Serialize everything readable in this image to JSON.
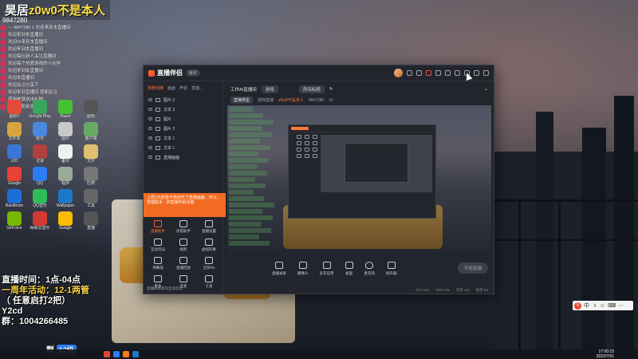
{
  "overlay": {
    "title_prefix": "昊居",
    "title_name": "z0w0不是本人",
    "count": "9847280",
    "chat": [
      "--- 9847280 1 欢迎来到本直播间",
      "欢迎来到本直播间",
      "欢迎ID来到本直播间",
      "欢迎来到本直播间",
      "欢迎每位新人关注直播间",
      "欢迎每个热爱游戏的小伙伴",
      "欢迎来到本直播间",
      "欢迎本直播间",
      "欢迎关注分享下",
      "欢迎来到直播间 感谢关注",
      "感谢老铁送出礼物",
      "欢迎新朋友加入"
    ],
    "schedule_line1": "直播时间：1点-04点",
    "schedule_line2": "一周年活动：12-1两管",
    "schedule_line3": "（ 任意启打2把）",
    "schedule_user": "Y2cd",
    "qq_group": "群：1004266485",
    "fan_group": "群",
    "fan_level": "12级"
  },
  "desktop_icons": [
    {
      "label": "图标1",
      "color": "#e34b3a"
    },
    {
      "label": "Google Play",
      "color": "#3aa55c"
    },
    {
      "label": "Razer",
      "color": "#44c033"
    },
    {
      "label": "图标",
      "color": "#555"
    },
    {
      "label": "文件夹",
      "color": "#d9a43b"
    },
    {
      "label": "软件",
      "color": "#4a88e0"
    },
    {
      "label": "图片",
      "color": "#c9c9c9"
    },
    {
      "label": "客户端",
      "color": "#6a6"
    },
    {
      "label": "z20",
      "color": "#3a76d8"
    },
    {
      "label": "记录",
      "color": "#b04040"
    },
    {
      "label": "备份",
      "color": "#f0f0f0"
    },
    {
      "label": "文件",
      "color": "#e0c070"
    },
    {
      "label": "Google Chrome",
      "color": "#e94235"
    },
    {
      "label": "QQ",
      "color": "#2c7cf6"
    },
    {
      "label": "程序",
      "color": "#9a9"
    },
    {
      "label": "应用",
      "color": "#777"
    },
    {
      "label": "Bandicam",
      "color": "#1e6ed8"
    },
    {
      "label": "QQ音乐",
      "color": "#2ebd59"
    },
    {
      "label": "Wallpaper Engine",
      "color": "#1d78c8"
    },
    {
      "label": "工具",
      "color": "#666"
    },
    {
      "label": "GeForce Experience",
      "color": "#76b900"
    },
    {
      "label": "网易云音乐",
      "color": "#d33a31"
    },
    {
      "label": "Google Chrome",
      "color": "#fbbc04"
    },
    {
      "label": "直播",
      "color": "#555"
    }
  ],
  "taskbar": {
    "time": "17:00:23",
    "date": "2022/7/31"
  },
  "ime": {
    "labels": [
      "中",
      "ゝ",
      "☺",
      "⌨",
      "⋯"
    ]
  },
  "app": {
    "name": "直播伴侣",
    "version": "版本",
    "left_tabs": [
      "场景切换",
      "画面",
      "声音",
      "直播..."
    ],
    "sources": [
      {
        "name": "图片 2"
      },
      {
        "name": "文本 2"
      },
      {
        "name": "图片"
      },
      {
        "name": "图片 3"
      },
      {
        "name": "文本 1"
      },
      {
        "name": "文本 1"
      },
      {
        "name": "直播画面"
      }
    ],
    "notice": "上周1元体验卡活动开了直播画面，可以，管理助手 · 并直播伴侣功能",
    "tools": [
      {
        "label": "直播助手",
        "active": true
      },
      {
        "label": "房管助手",
        "active": false
      },
      {
        "label": "直播设置",
        "active": false
      },
      {
        "label": "互动玩法",
        "active": false
      },
      {
        "label": "福利",
        "active": false
      },
      {
        "label": "虚拟形象",
        "active": false
      },
      {
        "label": "弹幕墙",
        "active": false
      },
      {
        "label": "直播回放",
        "active": false
      },
      {
        "label": "全民PK",
        "active": false
      },
      {
        "label": "更多",
        "active": false
      },
      {
        "label": "连麦",
        "active": false
      },
      {
        "label": "工具",
        "active": false
      }
    ],
    "warn": "直播间有新的互动消息",
    "room_title": "工作AI直播间",
    "room_tag": "游戏",
    "room_field": "房间标题",
    "category_label": "直播类型",
    "category_value": "游戏直播",
    "streamer": "z0w0不是本人",
    "room_id": "9847280",
    "fans": "16",
    "controls": [
      "直播录屏",
      "摄像头",
      "多开应用",
      "桌面",
      "麦克风",
      "扬声器"
    ],
    "start_button": "开始直播",
    "status": [
      "CPU 2%",
      "GPU 0%",
      "内存 4%",
      "帧率 60"
    ]
  }
}
